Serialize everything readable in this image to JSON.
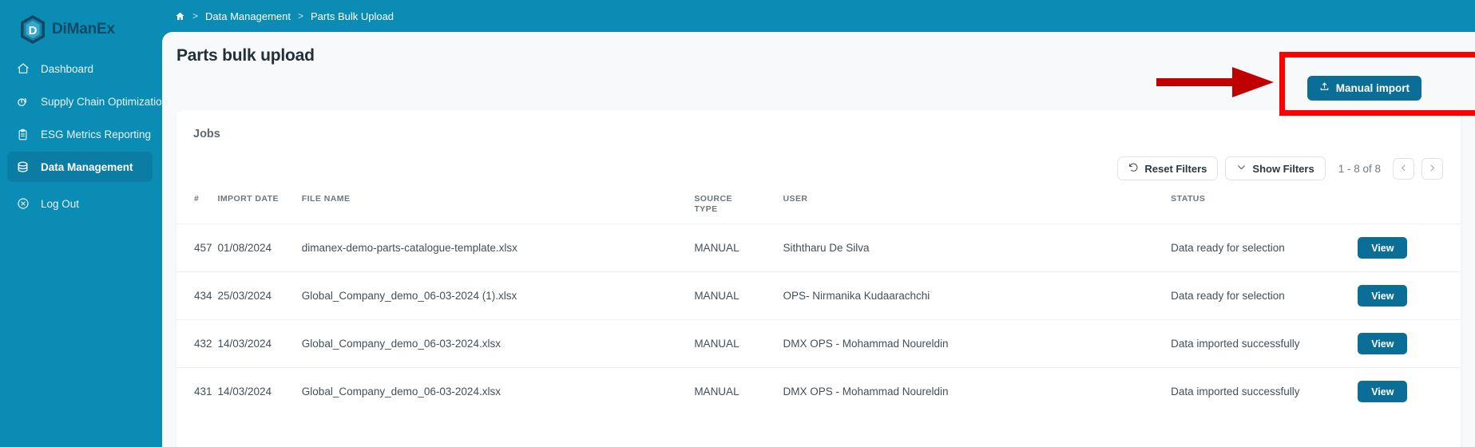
{
  "brand": {
    "name": "DiManEx",
    "logo_icon": "dimanex-hexagon-logo"
  },
  "sidebar": {
    "items": [
      {
        "label": "Dashboard",
        "icon": "home-icon",
        "active": false
      },
      {
        "label": "Supply Chain Optimization",
        "icon": "chart-pie-icon",
        "active": false
      },
      {
        "label": "ESG Metrics Reporting",
        "icon": "clipboard-icon",
        "active": false
      },
      {
        "label": "Data Management",
        "icon": "database-icon",
        "active": true
      },
      {
        "label": "Log Out",
        "icon": "logout-circle-icon",
        "active": false
      }
    ]
  },
  "breadcrumb": {
    "home_icon": "home-icon",
    "separator": ">",
    "items": [
      "Data Management",
      "Parts Bulk Upload"
    ]
  },
  "page": {
    "title": "Parts bulk upload",
    "manual_import_label": "Manual import",
    "manual_import_icon": "upload-icon"
  },
  "jobs": {
    "title": "Jobs",
    "toolbar": {
      "reset_filters_label": "Reset Filters",
      "reset_filters_icon": "refresh-ccw-icon",
      "show_filters_label": "Show Filters",
      "show_filters_icon": "chevron-down-icon",
      "range_label": "1 - 8 of 8",
      "prev_icon": "chevron-left-icon",
      "next_icon": "chevron-right-icon"
    },
    "columns": [
      "#",
      "IMPORT DATE",
      "FILE NAME",
      "SOURCE TYPE",
      "USER",
      "STATUS",
      ""
    ],
    "rows": [
      {
        "num": "457",
        "date": "01/08/2024",
        "file": "dimanex-demo-parts-catalogue-template.xlsx",
        "source": "MANUAL",
        "user": "Siththaru De Silva",
        "status": "Data ready for selection",
        "action": "View"
      },
      {
        "num": "434",
        "date": "25/03/2024",
        "file": "Global_Company_demo_06-03-2024 (1).xlsx",
        "source": "MANUAL",
        "user": "OPS- Nirmanika Kudaarachchi",
        "status": "Data ready for selection",
        "action": "View"
      },
      {
        "num": "432",
        "date": "14/03/2024",
        "file": "Global_Company_demo_06-03-2024.xlsx",
        "source": "MANUAL",
        "user": "DMX OPS - Mohammad Noureldin",
        "status": "Data imported successfully",
        "action": "View"
      },
      {
        "num": "431",
        "date": "14/03/2024",
        "file": "Global_Company_demo_06-03-2024.xlsx",
        "source": "MANUAL",
        "user": "DMX OPS - Mohammad Noureldin",
        "status": "Data imported successfully",
        "action": "View"
      }
    ]
  },
  "annotations": {
    "highlight_color": "#ff0000",
    "arrow_color": "#c00000",
    "target": "manual-import-button"
  },
  "colors": {
    "sidebar_bg": "#0a8cb5",
    "sidebar_active": "#0b7ca3",
    "primary_button": "#0a6e96",
    "surface": "#f7f9fa",
    "card": "#ffffff"
  }
}
